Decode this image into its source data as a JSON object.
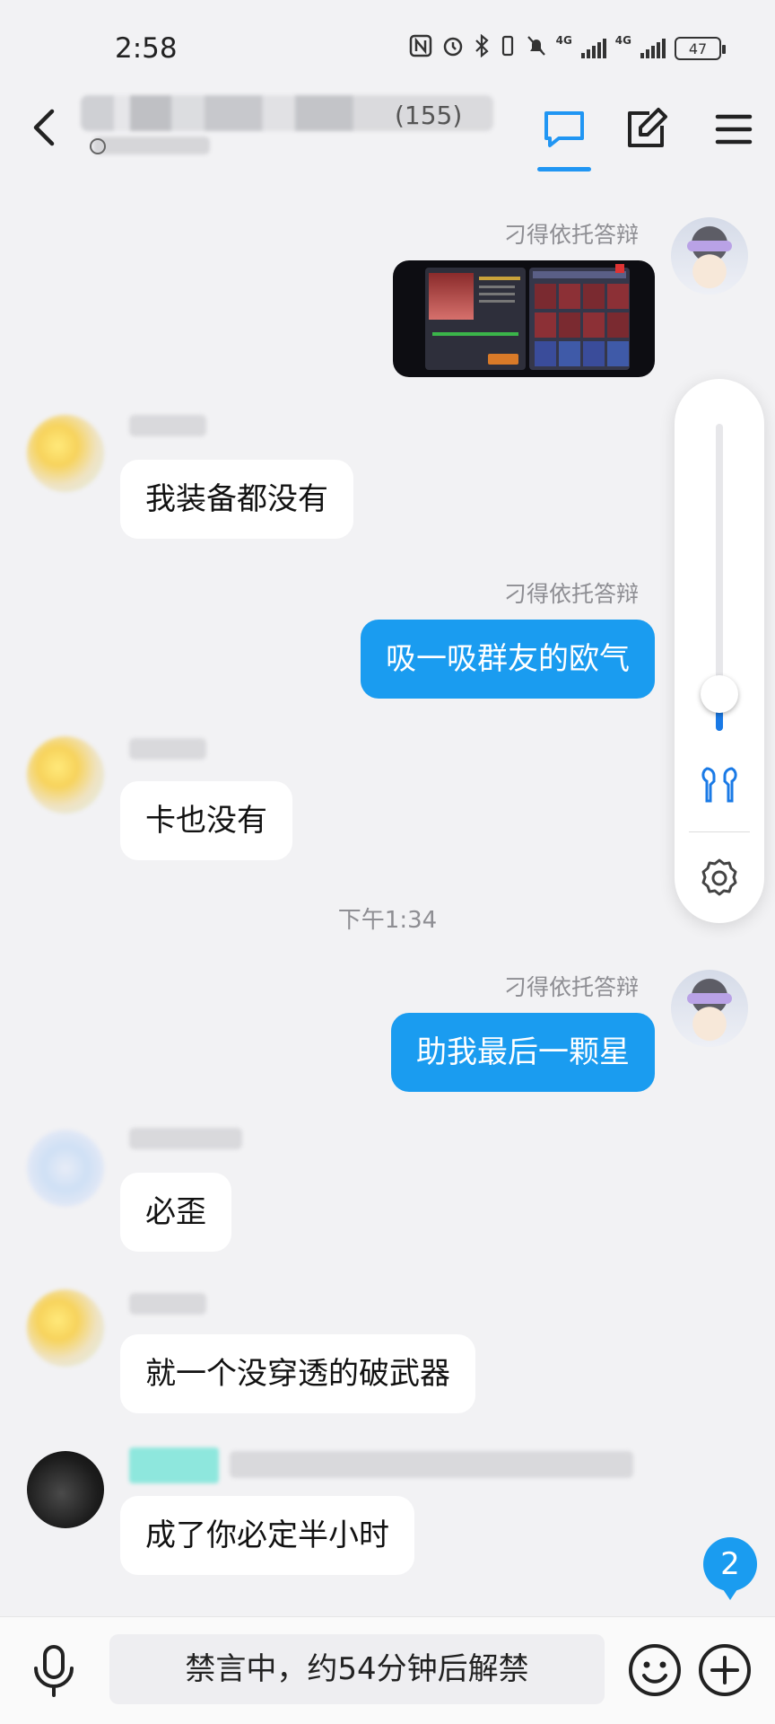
{
  "status_bar": {
    "time": "2:58",
    "network_1": "4G",
    "network_2": "4G",
    "battery": "47"
  },
  "header": {
    "member_count": "(155)",
    "tabs": [
      {
        "icon": "chat-bubble-icon",
        "active": true
      },
      {
        "icon": "edit-icon",
        "active": false
      }
    ],
    "accent_color": "#2196f3"
  },
  "messages": [
    {
      "id": "m1",
      "sender": "刁得依托答辩",
      "direction": "out",
      "type": "image"
    },
    {
      "id": "m2",
      "sender": "",
      "direction": "in",
      "text": "我装备都没有"
    },
    {
      "id": "m3",
      "sender": "刁得依托答辩",
      "direction": "out",
      "text": "吸一吸群友的欧气"
    },
    {
      "id": "m4",
      "sender": "",
      "direction": "in",
      "text": "卡也没有"
    },
    {
      "id": "t1",
      "type": "timestamp",
      "text": "下午1:34"
    },
    {
      "id": "m5",
      "sender": "刁得依托答辩",
      "direction": "out",
      "text": "助我最后一颗星"
    },
    {
      "id": "m6",
      "sender": "",
      "direction": "in",
      "text": "必歪"
    },
    {
      "id": "m7",
      "sender": "",
      "direction": "in",
      "text": "就一个没穿透的破武器"
    },
    {
      "id": "m8",
      "sender": "",
      "direction": "in",
      "text": "成了你必定半小时"
    }
  ],
  "volume_panel": {
    "level": 0.12,
    "icons": [
      "earbuds-icon",
      "settings-gear-icon"
    ]
  },
  "unread_badge": "2",
  "input_bar": {
    "placeholder": "禁言中，约54分钟后解禁",
    "icons": [
      "microphone-icon",
      "emoji-icon",
      "plus-icon"
    ]
  },
  "colors": {
    "bubble_out": "#1a9cf0",
    "bubble_in": "#ffffff",
    "background": "#f2f2f4"
  }
}
